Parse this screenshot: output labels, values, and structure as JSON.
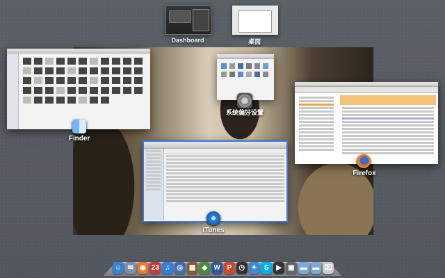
{
  "spaces": [
    {
      "label": "Dashboard"
    },
    {
      "label": "桌面"
    }
  ],
  "windows": {
    "finder_label": "Finder",
    "itunes_label": "iTunes",
    "firefox_label": "Firefox",
    "sysprefs_label": "系统偏好设置"
  },
  "dock": {
    "items": [
      {
        "name": "finder",
        "glyph": "☺",
        "color": "#3a7fd0"
      },
      {
        "name": "mail",
        "glyph": "✉",
        "color": "#7d8fa8"
      },
      {
        "name": "firefox",
        "glyph": "◉",
        "color": "#e8782a"
      },
      {
        "name": "calendar",
        "glyph": "23",
        "color": "#c93a3a"
      },
      {
        "name": "itunes",
        "glyph": "♫",
        "color": "#2d7fe0"
      },
      {
        "name": "network",
        "glyph": "◎",
        "color": "#3d6fb8"
      },
      {
        "name": "photo",
        "glyph": "▦",
        "color": "#8b5a2b"
      },
      {
        "name": "maps",
        "glyph": "◆",
        "color": "#4a8c3a"
      },
      {
        "name": "word",
        "glyph": "W",
        "color": "#2b579a"
      },
      {
        "name": "powerpoint",
        "glyph": "P",
        "color": "#d24726"
      },
      {
        "name": "clock",
        "glyph": "◷",
        "color": "#333333"
      },
      {
        "name": "qq",
        "glyph": "✦",
        "color": "#3b8ad8"
      },
      {
        "name": "skype",
        "glyph": "S",
        "color": "#00aff0"
      },
      {
        "name": "media",
        "glyph": "▶",
        "color": "#333333"
      },
      {
        "name": "apps",
        "glyph": "▣",
        "color": "#666666"
      },
      {
        "name": "folder",
        "glyph": "▬",
        "color": "#7aaad8"
      },
      {
        "name": "downloads",
        "glyph": "▬",
        "color": "#7aaad8"
      },
      {
        "name": "trash",
        "glyph": "⌧",
        "color": "#c8ccd2"
      }
    ]
  }
}
